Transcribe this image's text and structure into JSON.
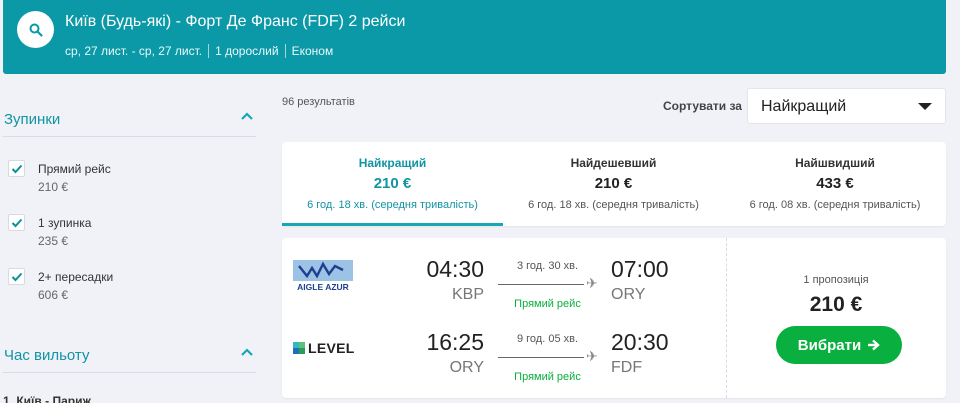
{
  "header": {
    "title": "Київ (Будь-які) - Форт Де Франс (FDF) 2 рейси",
    "dates": "ср, 27 лист. - ср, 27 лист.",
    "passengers": "1 дорослий",
    "cabin": "Економ",
    "search_icon": "search-icon",
    "color": "#0b99a7"
  },
  "sidebar": {
    "stops": {
      "title": "Зупинки",
      "items": [
        {
          "label": "Прямий рейс",
          "price": "210 €",
          "checked": true
        },
        {
          "label": "1 зупинка",
          "price": "235 €",
          "checked": true
        },
        {
          "label": "2+ пересадки",
          "price": "606 €",
          "checked": true
        }
      ]
    },
    "departure": {
      "title": "Час вильоту",
      "route": "1. Київ - Париж"
    }
  },
  "results": {
    "count": "96 результатів",
    "sort_label": "Сортувати за",
    "sort_value": "Найкращий"
  },
  "tabs": [
    {
      "name": "Найкращий",
      "price": "210 €",
      "duration": "6 год. 18 хв. (середня тривалість)",
      "active": true
    },
    {
      "name": "Найдешевший",
      "price": "210 €",
      "duration": "6 год. 18 хв. (середня тривалість)",
      "active": false
    },
    {
      "name": "Найшвидший",
      "price": "433 €",
      "duration": "6 год. 08 хв. (середня тривалість)",
      "active": false
    }
  ],
  "card": {
    "legs": [
      {
        "airline": "AIGLE AZUR",
        "dep_time": "04:30",
        "dep_code": "KBP",
        "duration": "3 год. 30 хв.",
        "stops": "Прямий рейс",
        "arr_time": "07:00",
        "arr_code": "ORY"
      },
      {
        "airline": "LEVEL",
        "dep_time": "16:25",
        "dep_code": "ORY",
        "duration": "9 год. 05 хв.",
        "stops": "Прямий рейс",
        "arr_time": "20:30",
        "arr_code": "FDF"
      }
    ],
    "offers": "1 пропозиція",
    "price": "210 €",
    "select_label": "Вибрати",
    "select_color": "#0ab03f"
  }
}
